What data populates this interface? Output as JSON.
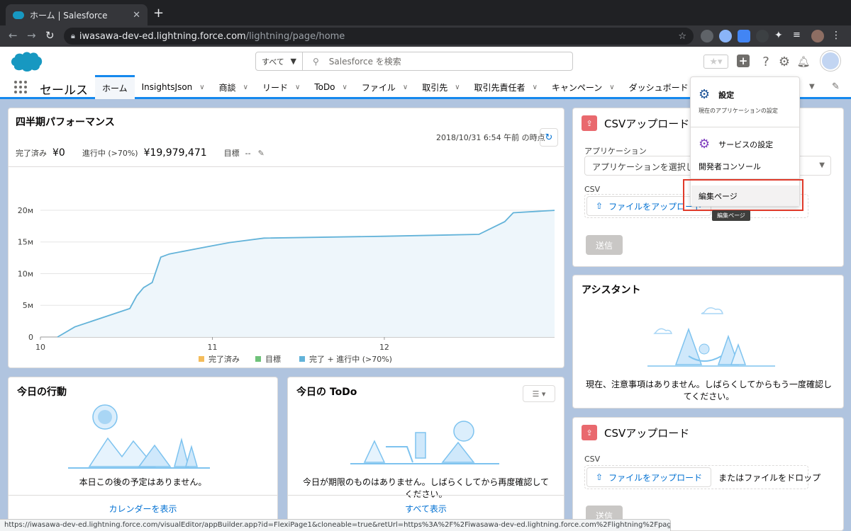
{
  "browser": {
    "tab_title": "ホーム | Salesforce",
    "url_host": "iwasawa-dev-ed.lightning.force.com",
    "url_path": "/lightning/page/home",
    "status_url": "https://iwasawa-dev-ed.lightning.force.com/visualEditor/appBuilder.app?id=FlexiPage1&cloneable=true&retUrl=https%3A%2F%2Fiwasawa-dev-ed.lightning.force.com%2Flightning%2Fpage%2Fhome"
  },
  "header": {
    "search_scope": "すべて",
    "search_placeholder": "Salesforce を検索"
  },
  "appnav": {
    "app_name": "セールス",
    "items": [
      {
        "label": "ホーム",
        "active": true
      },
      {
        "label": "InsightsJson"
      },
      {
        "label": "商談"
      },
      {
        "label": "リード"
      },
      {
        "label": "ToDo"
      },
      {
        "label": "ファイル"
      },
      {
        "label": "取引先"
      },
      {
        "label": "取引先責任者"
      },
      {
        "label": "キャンペーン"
      },
      {
        "label": "ダッシュボード"
      }
    ]
  },
  "perf": {
    "title": "四半期パフォーマンス",
    "as_of": "2018/10/31 6:54 午前 の時点",
    "closed_label": "完了済み",
    "closed_value": "¥0",
    "open_label": "進行中 (>70%)",
    "open_value": "¥19,979,471",
    "goal_label": "目標",
    "goal_value": "--"
  },
  "chart_data": {
    "type": "area",
    "x_ticks": [
      "10",
      "11",
      "12"
    ],
    "y_ticks": [
      "0",
      "5м",
      "10м",
      "15м",
      "20м"
    ],
    "ylim": [
      0,
      21
    ],
    "xlim": [
      0,
      2.99
    ],
    "legend": [
      "完了済み",
      "目標",
      "完了 + 進行中 (>70%)"
    ],
    "legend_colors": [
      "#f4bc5b",
      "#6fc27a",
      "#63b3d9"
    ],
    "grid": true,
    "series": [
      {
        "name": "完了 + 進行中 (>70%)",
        "x": [
          0.1,
          0.2,
          0.52,
          0.56,
          0.6,
          0.65,
          0.7,
          0.75,
          1.0,
          1.1,
          1.3,
          2.0,
          2.55,
          2.7,
          2.75,
          2.99
        ],
        "y": [
          0,
          1.6,
          4.5,
          6.5,
          7.8,
          8.6,
          12.6,
          13.1,
          14.4,
          14.9,
          15.6,
          15.9,
          16.2,
          18.2,
          19.6,
          19.98
        ]
      }
    ]
  },
  "csv1": {
    "title": "CSVアップロード",
    "app_label": "アプリケーション",
    "app_placeholder": "アプリケーションを選択して",
    "csv_label": "CSV",
    "upload_label": "ファイルをアップロード",
    "send_label": "送信"
  },
  "assistant": {
    "title": "アシスタント",
    "empty_text": "現在、注意事項はありません。しばらくしてからもう一度確認してください。"
  },
  "csv2": {
    "title": "CSVアップロード",
    "csv_label": "CSV",
    "upload_label": "ファイルをアップロード",
    "drop_text": "またはファイルをドロップ",
    "send_label": "送信"
  },
  "today": {
    "title": "今日の行動",
    "empty_text": "本日この後の予定はありません。",
    "footer_link": "カレンダーを表示"
  },
  "todo": {
    "title": "今日の ToDo",
    "empty_text": "今日が期限のものはありません。しばらくしてから再度確認してください。",
    "footer_link": "すべて表示"
  },
  "setup_menu": {
    "setup_label": "設定",
    "setup_sub": "現在のアプリケーションの設定",
    "service_label": "サービスの設定",
    "devconsole_label": "開発者コンソール",
    "edit_page_label": "編集ページ",
    "tooltip": "編集ページ"
  }
}
